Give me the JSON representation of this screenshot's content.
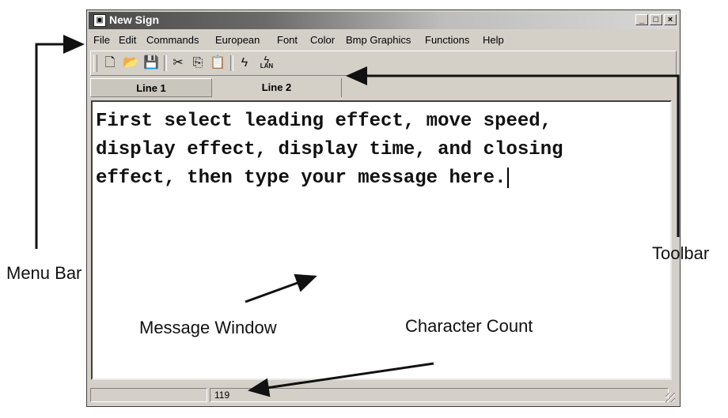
{
  "window": {
    "title": "New Sign",
    "controls": {
      "minimize": "_",
      "maximize": "□",
      "close": "×"
    }
  },
  "menubar": {
    "items": [
      {
        "label": "File"
      },
      {
        "label": "Edit"
      },
      {
        "label": "Commands"
      },
      {
        "label": "European"
      },
      {
        "label": "Font"
      },
      {
        "label": "Color"
      },
      {
        "label": "Bmp Graphics"
      },
      {
        "label": "Functions"
      },
      {
        "label": "Help"
      }
    ]
  },
  "toolbar": {
    "buttons": [
      {
        "icon": "new-document-icon"
      },
      {
        "icon": "open-folder-icon"
      },
      {
        "icon": "save-disk-icon"
      },
      {
        "icon": "cut-scissors-icon"
      },
      {
        "icon": "copy-icon"
      },
      {
        "icon": "paste-clipboard-icon"
      },
      {
        "icon": "send-lightning-icon"
      },
      {
        "icon": "send-lan-icon"
      }
    ],
    "lan_label": "LAN"
  },
  "tabs": [
    {
      "label": "Line 1",
      "active": true
    },
    {
      "label": "Line 2",
      "active": false
    }
  ],
  "editor": {
    "lines": [
      "First select leading effect, move speed,",
      "display effect, display time, and closing",
      "effect, then type your message here."
    ]
  },
  "statusbar": {
    "char_count": "119"
  },
  "annotations": {
    "menu_bar": "Menu Bar",
    "toolbar": "Toolbar",
    "message_window": "Message Window",
    "character_count": "Character Count"
  }
}
